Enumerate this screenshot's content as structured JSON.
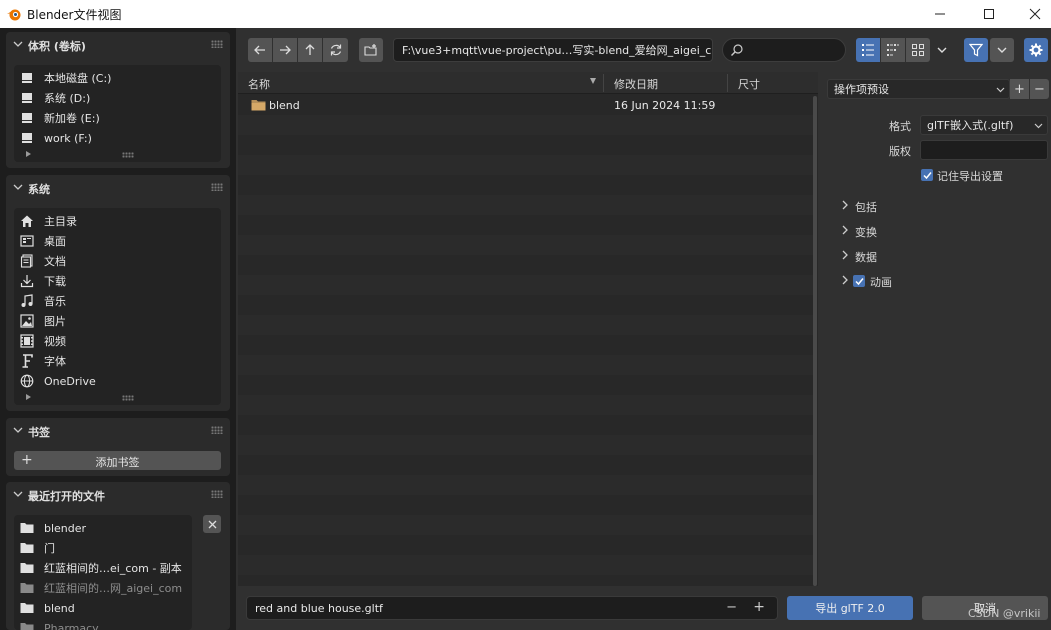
{
  "window": {
    "title": "Blender文件视图",
    "minimize": "—",
    "maximize": "☐",
    "close": "✕"
  },
  "sidebar": {
    "volumes": {
      "title": "体积 (卷标)",
      "items": [
        "本地磁盘 (C:)",
        "系统 (D:)",
        "新加卷 (E:)",
        "work (F:)"
      ]
    },
    "system": {
      "title": "系统",
      "items": [
        {
          "label": "主目录",
          "icon": "home-icon"
        },
        {
          "label": "桌面",
          "icon": "desktop-icon"
        },
        {
          "label": "文档",
          "icon": "documents-icon"
        },
        {
          "label": "下载",
          "icon": "download-icon"
        },
        {
          "label": "音乐",
          "icon": "music-icon"
        },
        {
          "label": "图片",
          "icon": "image-icon"
        },
        {
          "label": "视频",
          "icon": "video-icon"
        },
        {
          "label": "字体",
          "icon": "font-icon"
        },
        {
          "label": "OneDrive",
          "icon": "globe-icon"
        }
      ]
    },
    "bookmarks": {
      "title": "书签",
      "add_label": "添加书签"
    },
    "recent": {
      "title": "最近打开的文件",
      "items": [
        {
          "label": "blender",
          "dim": false
        },
        {
          "label": "门",
          "dim": false
        },
        {
          "label": "红蓝相间的…ei_com - 副本",
          "dim": false
        },
        {
          "label": "红蓝相间的…网_aigei_com",
          "dim": true
        },
        {
          "label": "blend",
          "dim": false
        },
        {
          "label": "Pharmacy",
          "dim": true
        }
      ]
    }
  },
  "toolbar": {
    "path": "F:\\vue3+mqtt\\vue-project\\pu…写实-blend_爱给网_aigei_com\\",
    "search_placeholder": ""
  },
  "filelist": {
    "columns": {
      "name": "名称",
      "date": "修改日期",
      "size": "尺寸"
    },
    "rows": [
      {
        "name": "blend",
        "date": "16 Jun 2024 11:59",
        "size": ""
      }
    ]
  },
  "rightpanel": {
    "preset_label": "操作项预设",
    "format_label": "格式",
    "format_value": "glTF嵌入式(.gltf)",
    "copyright_label": "版权",
    "copyright_value": "",
    "remember_label": "记住导出设置",
    "groups": [
      {
        "label": "包括",
        "checkbox": false
      },
      {
        "label": "变换",
        "checkbox": false
      },
      {
        "label": "数据",
        "checkbox": false
      },
      {
        "label": "动画",
        "checkbox": true
      }
    ]
  },
  "bottombar": {
    "filename": "red and blue house.gltf",
    "export_label": "导出 glTF 2.0",
    "cancel_label": "取消"
  },
  "watermark": "CSDN @vrikii",
  "colors": {
    "accent": "#4772b3",
    "background": "#303030",
    "panel": "#1d1d1d"
  }
}
